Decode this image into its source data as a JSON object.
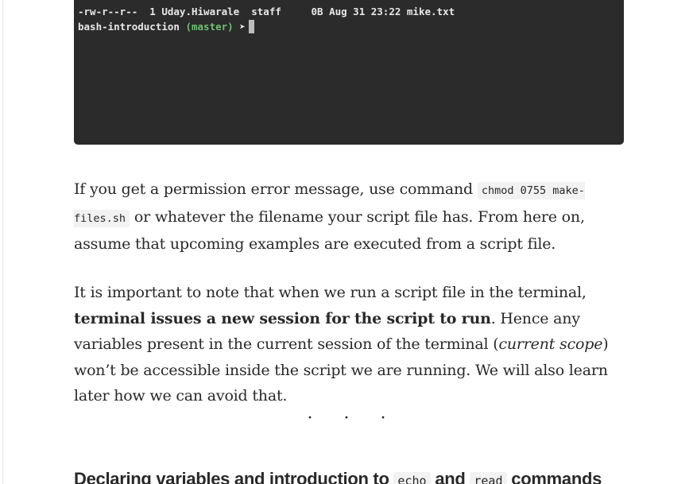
{
  "terminal": {
    "line1": "-rw-r--r--  1 Uday.Hiwarale  staff     0B Aug 31 23:22 mike.txt",
    "prompt_dir": "bash-introduction",
    "prompt_branch": "(master)",
    "prompt_arrow": "➤"
  },
  "paragraph1": {
    "text_before": "If you get a permission error message, use command ",
    "code": "chmod 0755 make-files.sh",
    "text_after": " or whatever the filename your script file has. From here on, assume that upcoming examples are executed from a script file."
  },
  "paragraph2": {
    "text_before": "It is important to note that when we run a script file in the terminal, ",
    "bold": "terminal issues a new session for the script to run",
    "text_middle": ". Hence any variables present in the current session of the terminal (",
    "italic": "current scope",
    "text_after": ") won’t be accessible inside the script we are running. We will also learn later how we can avoid that."
  },
  "separator": "· · ·",
  "heading": {
    "text_before": "Declaring variables and introduction to ",
    "code1": "echo",
    "text_middle": " and ",
    "code2": "read",
    "text_after": " commands"
  }
}
